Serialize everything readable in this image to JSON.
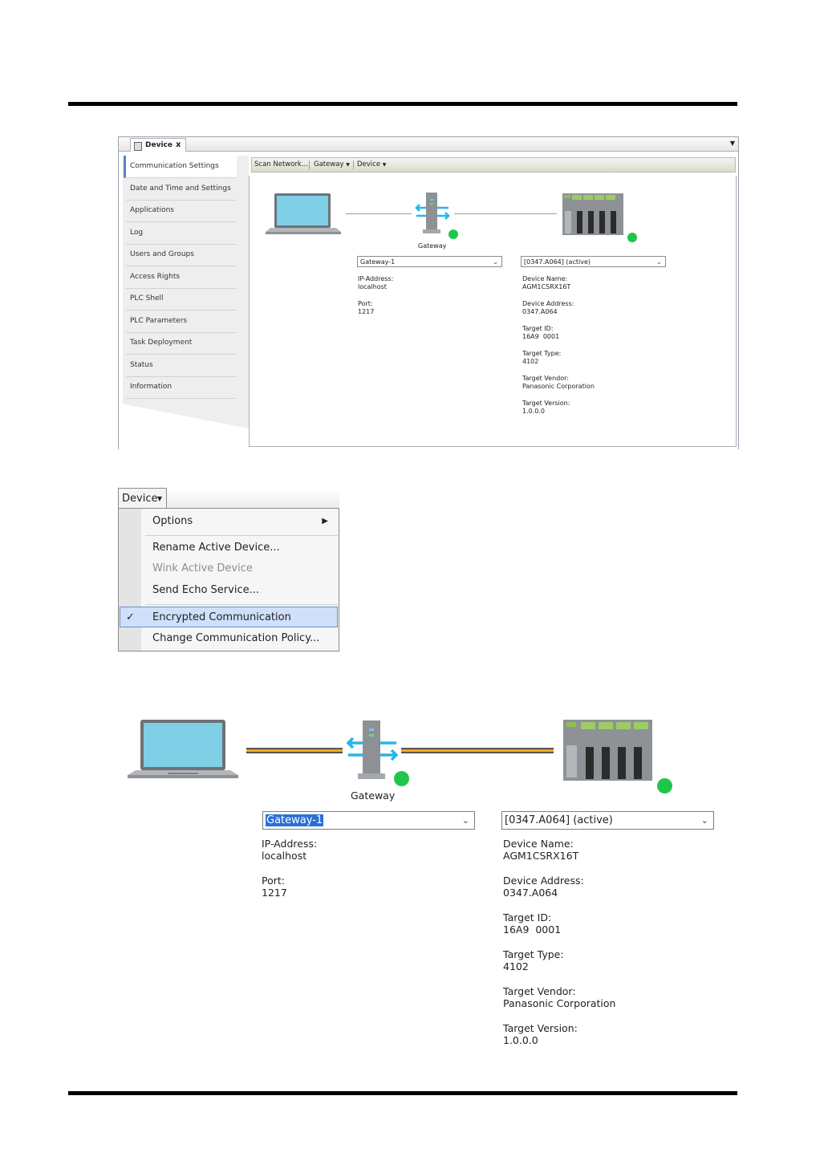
{
  "colors": {
    "status_ok": "#1ec74c",
    "link_line": "#f5a623",
    "selection": "#2b6fd6"
  },
  "screenshot1": {
    "tab_title": "Device",
    "tab_close": "x",
    "sidebar": [
      "Communication Settings",
      "Date and Time and Settings",
      "Applications",
      "Log",
      "Users and Groups",
      "Access Rights",
      "PLC Shell",
      "PLC Parameters",
      "Task Deployment",
      "Status",
      "Information"
    ],
    "toolbar": {
      "scan": "Scan Network...",
      "gateway": "Gateway",
      "device": "Device"
    },
    "gateway_label": "Gateway",
    "gateway_combo": "Gateway-1",
    "ip_label": "IP-Address:",
    "ip_value": "localhost",
    "port_label": "Port:",
    "port_value": "1217",
    "device_combo": "[0347.A064] (active)",
    "device_name_label": "Device Name:",
    "device_name": "AGM1CSRX16T",
    "device_address_label": "Device Address:",
    "device_address": "0347.A064",
    "target_id_label": "Target ID:",
    "target_id": "16A9  0001",
    "target_type_label": "Target Type:",
    "target_type": "4102",
    "target_vendor_label": "Target Vendor:",
    "target_vendor": "Panasonic Corporation",
    "target_version_label": "Target Version:",
    "target_version": "1.0.0.0"
  },
  "screenshot2": {
    "menu_button": "Device",
    "items": {
      "options": "Options",
      "rename": "Rename Active Device...",
      "wink": "Wink Active Device",
      "echo": "Send Echo Service...",
      "encrypted": "Encrypted Communication",
      "policy": "Change Communication Policy..."
    }
  },
  "screenshot3": {
    "gateway_label": "Gateway",
    "gateway_combo": "Gateway-1",
    "ip_label": "IP-Address:",
    "ip_value": "localhost",
    "port_label": "Port:",
    "port_value": "1217",
    "device_combo": "[0347.A064] (active)",
    "device_name_label": "Device Name:",
    "device_name": "AGM1CSRX16T",
    "device_address_label": "Device Address:",
    "device_address": "0347.A064",
    "target_id_label": "Target ID:",
    "target_id": "16A9  0001",
    "target_type_label": "Target Type:",
    "target_type": "4102",
    "target_vendor_label": "Target Vendor:",
    "target_vendor": "Panasonic Corporation",
    "target_version_label": "Target Version:",
    "target_version": "1.0.0.0"
  }
}
